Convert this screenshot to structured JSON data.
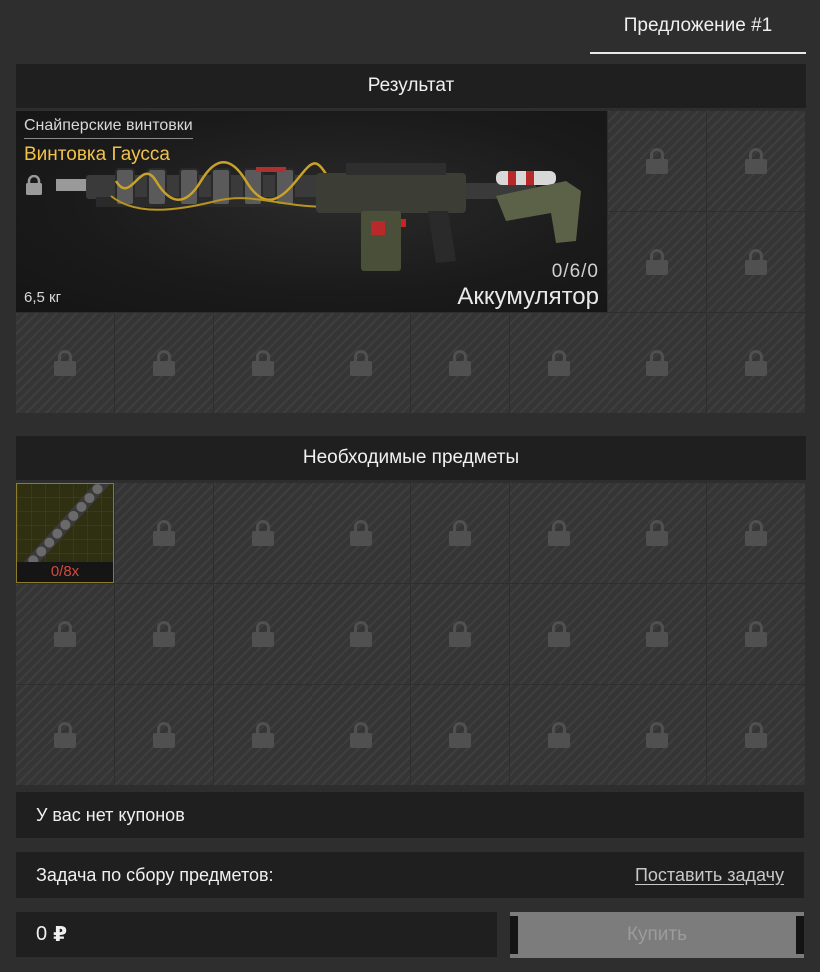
{
  "tab": {
    "label": "Предложение #1"
  },
  "result": {
    "header": "Результат",
    "item": {
      "category": "Снайперские винтовки",
      "name": "Винтовка Гаусса",
      "weight": "6,5 кг",
      "counts": "0/6/0",
      "slot_name": "Аккумулятор",
      "name_color": "#f0c24a"
    }
  },
  "required": {
    "header": "Необходимые предметы",
    "first_item_qty": "0/8x",
    "qty_color": "#d34b3f"
  },
  "coupons": {
    "text": "У вас нет купонов"
  },
  "task": {
    "label": "Задача по сбору предметов:",
    "link": "Поставить задачу"
  },
  "price": {
    "amount": "0",
    "currency": "₽"
  },
  "buy": {
    "label": "Купить"
  }
}
